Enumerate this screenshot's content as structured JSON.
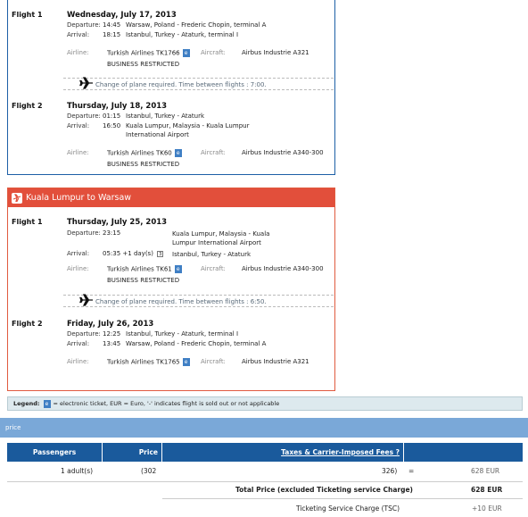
{
  "outbound": {
    "flights": [
      {
        "label": "Flight 1",
        "date": "Wednesday, July 17, 2013",
        "departure": {
          "label": "Departure:",
          "time": "14:45",
          "place": "Warsaw, Poland - Frederic Chopin, terminal A"
        },
        "arrival": {
          "label": "Arrival:",
          "time": "18:15",
          "place": "Istanbul, Turkey - Ataturk, terminal I"
        },
        "airline_label": "Airline:",
        "airline": "Turkish Airlines TK1766",
        "aircraft_label": "Aircraft:",
        "aircraft": "Airbus Industrie A321",
        "restriction": "BUSINESS RESTRICTED"
      },
      {
        "label": "Flight 2",
        "date": "Thursday, July 18, 2013",
        "departure": {
          "label": "Departure:",
          "time": "01:15",
          "place": "Istanbul, Turkey - Ataturk"
        },
        "arrival": {
          "label": "Arrival:",
          "time": "16:50",
          "place": "Kuala Lumpur, Malaysia - Kuala Lumpur",
          "place_line2": "International Airport"
        },
        "airline_label": "Airline:",
        "airline": "Turkish Airlines TK60",
        "aircraft_label": "Aircraft:",
        "aircraft": "Airbus Industrie A340-300",
        "restriction": "BUSINESS RESTRICTED"
      }
    ],
    "change_text": "Change of plane required. Time between flights : 7:00."
  },
  "return": {
    "title": "Kuala Lumpur to Warsaw",
    "flights": [
      {
        "label": "Flight 1",
        "date": "Thursday, July 25, 2013",
        "departure": {
          "label": "Departure:",
          "time": "23:15",
          "place": "Kuala Lumpur, Malaysia - Kuala",
          "place_line2": "Lumpur International Airport"
        },
        "arrival": {
          "label": "Arrival:",
          "time": "05:35 +1 day(s)",
          "place": "Istanbul, Turkey - Ataturk"
        },
        "airline_label": "Airline:",
        "airline": "Turkish Airlines TK61",
        "aircraft_label": "Aircraft:",
        "aircraft": "Airbus Industrie A340-300",
        "restriction": "BUSINESS RESTRICTED"
      },
      {
        "label": "Flight 2",
        "date": "Friday, July 26, 2013",
        "departure": {
          "label": "Departure:",
          "time": "12:25",
          "place": "Istanbul, Turkey - Ataturk, terminal I"
        },
        "arrival": {
          "label": "Arrival:",
          "time": "13:45",
          "place": "Warsaw, Poland - Frederic Chopin, terminal A"
        },
        "airline_label": "Airline:",
        "airline": "Turkish Airlines TK1765",
        "aircraft_label": "Aircraft:",
        "aircraft": "Airbus Industrie A321"
      }
    ],
    "change_text": "Change of plane required. Time between flights : 6:50."
  },
  "legend": {
    "label": "Legend:",
    "badge": "e",
    "text": "= electronic ticket,   EUR  = Euro, '-' indicates flight is sold out or not applicable"
  },
  "price_bar": "price",
  "price_table": {
    "headers": {
      "passengers": "Passengers",
      "price": "Price",
      "taxes": "Taxes & Carrier-Imposed Fees ?"
    },
    "row": {
      "passengers": "1 adult(s)",
      "price": "(302",
      "taxes": "326)",
      "equals": "=",
      "total": "628 EUR"
    },
    "total_label": "Total Price (excluded Ticketing service Charge)",
    "total_value": "628 EUR",
    "tsc_label": "Ticketing Service Charge (TSC)",
    "tsc_value": "+10 EUR"
  },
  "icons": {
    "ebadge": "e-ticket-badge",
    "plane": "airplane-icon",
    "day_badge": "3"
  },
  "colors": {
    "blue": "#1a5a9c",
    "red": "#e24f3b",
    "price_bar": "#7aa8d8",
    "legend_bg": "#dde9ee",
    "badge": "#3f7fc4"
  }
}
